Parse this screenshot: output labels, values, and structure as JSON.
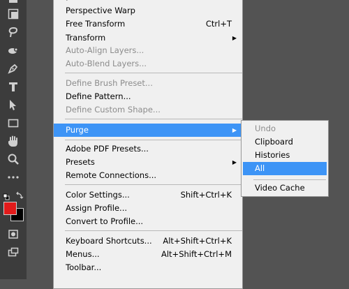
{
  "colors": {
    "foreground": "#e21b1b",
    "background": "#000000",
    "highlight": "#3d94f6"
  },
  "toolbar": {
    "tools": [
      "partial-tool-icon",
      "marquee-tool-icon",
      "lasso-tool-icon",
      "healing-brush-tool-icon",
      "pen-tool-icon",
      "type-tool-icon",
      "path-selection-tool-icon",
      "rectangle-tool-icon",
      "hand-tool-icon",
      "zoom-tool-icon",
      "more-tools-icon"
    ]
  },
  "menu": {
    "items": [
      {
        "label": "Perspective Warp",
        "shortcut": "",
        "disabled": false,
        "submenu": false
      },
      {
        "label": "Free Transform",
        "shortcut": "Ctrl+T",
        "disabled": false,
        "submenu": false
      },
      {
        "label": "Transform",
        "shortcut": "",
        "disabled": false,
        "submenu": true
      },
      {
        "label": "Auto-Align Layers...",
        "shortcut": "",
        "disabled": true,
        "submenu": false
      },
      {
        "label": "Auto-Blend Layers...",
        "shortcut": "",
        "disabled": true,
        "submenu": false
      },
      {
        "label": "Define Brush Preset...",
        "shortcut": "",
        "disabled": true,
        "submenu": false
      },
      {
        "label": "Define Pattern...",
        "shortcut": "",
        "disabled": false,
        "submenu": false
      },
      {
        "label": "Define Custom Shape...",
        "shortcut": "",
        "disabled": true,
        "submenu": false
      },
      {
        "label": "Purge",
        "shortcut": "",
        "disabled": false,
        "submenu": true,
        "highlighted": true
      },
      {
        "label": "Adobe PDF Presets...",
        "shortcut": "",
        "disabled": false,
        "submenu": false
      },
      {
        "label": "Presets",
        "shortcut": "",
        "disabled": false,
        "submenu": true
      },
      {
        "label": "Remote Connections...",
        "shortcut": "",
        "disabled": false,
        "submenu": false
      },
      {
        "label": "Color Settings...",
        "shortcut": "Shift+Ctrl+K",
        "disabled": false,
        "submenu": false
      },
      {
        "label": "Assign Profile...",
        "shortcut": "",
        "disabled": false,
        "submenu": false
      },
      {
        "label": "Convert to Profile...",
        "shortcut": "",
        "disabled": false,
        "submenu": false
      },
      {
        "label": "Keyboard Shortcuts...",
        "shortcut": "Alt+Shift+Ctrl+K",
        "disabled": false,
        "submenu": false
      },
      {
        "label": "Menus...",
        "shortcut": "Alt+Shift+Ctrl+M",
        "disabled": false,
        "submenu": false
      },
      {
        "label": "Toolbar...",
        "shortcut": "",
        "disabled": false,
        "submenu": false
      }
    ]
  },
  "purge_submenu": {
    "items": [
      {
        "label": "Undo",
        "disabled": true
      },
      {
        "label": "Clipboard",
        "disabled": false
      },
      {
        "label": "Histories",
        "disabled": false
      },
      {
        "label": "All",
        "disabled": false,
        "highlighted": true
      },
      {
        "label": "Video Cache",
        "disabled": false
      }
    ]
  }
}
